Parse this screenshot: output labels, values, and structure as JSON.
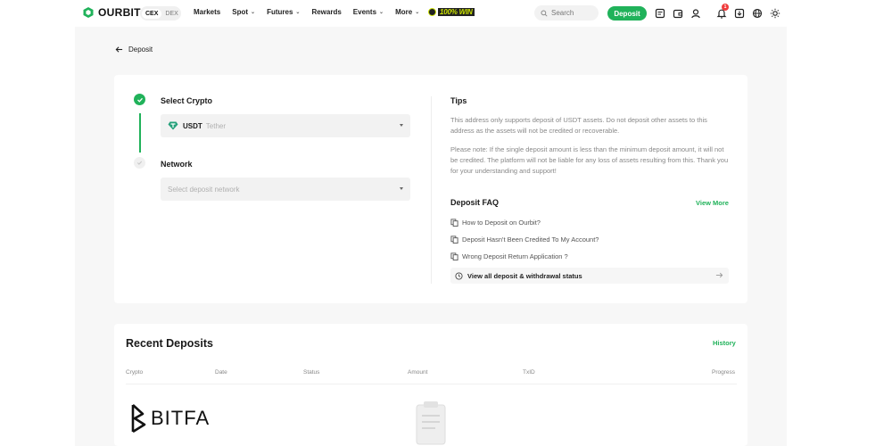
{
  "header": {
    "logo_text": "OURBIT",
    "toggle": {
      "cex": "CEX",
      "dex": "DEX"
    },
    "nav": [
      {
        "label": "Markets",
        "dropdown": false
      },
      {
        "label": "Spot",
        "dropdown": true
      },
      {
        "label": "Futures",
        "dropdown": true
      },
      {
        "label": "Rewards",
        "dropdown": false
      },
      {
        "label": "Events",
        "dropdown": true
      },
      {
        "label": "More",
        "dropdown": true
      }
    ],
    "promo_badge": "100% WIN",
    "search_placeholder": "Search",
    "deposit_label": "Deposit",
    "notification_count": "1",
    "icons": [
      "orders-icon",
      "wallet-icon",
      "user-icon",
      "bell-icon",
      "download-icon",
      "globe-icon",
      "theme-sun-icon"
    ]
  },
  "back": {
    "label": "Deposit"
  },
  "steps": {
    "select_crypto": {
      "label": "Select Crypto",
      "selected_symbol": "USDT",
      "selected_name": "Tether"
    },
    "network": {
      "label": "Network",
      "placeholder": "Select deposit network"
    }
  },
  "tips": {
    "title": "Tips",
    "p1": "This address only supports deposit of USDT assets. Do not deposit other assets to this address as the assets will not be credited or recoverable.",
    "p2": "Please note: If the single deposit amount is less than the minimum deposit amount, it will not be credited. The platform will not be liable for any loss of assets resulting from this. Thank you for your understanding and support!"
  },
  "faq": {
    "title": "Deposit FAQ",
    "view_more": "View More",
    "items": [
      "How to Deposit on Ourbit?",
      "Deposit Hasn't Been Credited To My Account?",
      "Wrong Deposit Return Application ?"
    ],
    "status_link": "View all deposit & withdrawal status"
  },
  "recent": {
    "title": "Recent Deposits",
    "history": "History",
    "columns": [
      "Crypto",
      "Date",
      "Status",
      "Amount",
      "TxID",
      "Progress"
    ]
  },
  "watermark": "BITFA",
  "colors": {
    "accent": "#20b25a",
    "alert": "#f03c3c"
  }
}
